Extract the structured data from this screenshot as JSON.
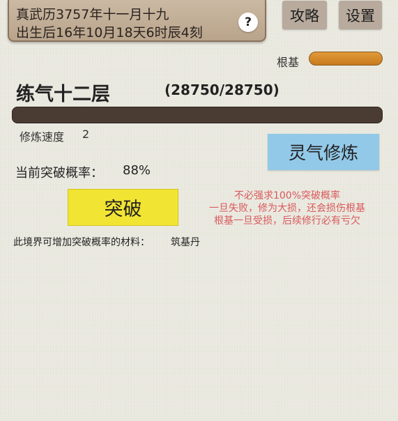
{
  "header": {
    "date_line1": "真武历3757年十一月十九",
    "date_line2": "出生后16年10月18天6时辰4刻",
    "help_label": "?",
    "guide_label": "攻略",
    "settings_label": "设置"
  },
  "root": {
    "label": "根基",
    "level": 1.0,
    "color": "#d8902e"
  },
  "realm": {
    "name": "练气十二层",
    "progress_text": "(28750/28750)",
    "progress_current": 28750,
    "progress_max": 28750,
    "bar_color": "#4a3b33"
  },
  "cultivation": {
    "speed_label": "修炼速度",
    "speed_value": "2",
    "qi_button_label": "灵气修炼"
  },
  "breakthrough": {
    "chance_label": "当前突破概率：",
    "chance_value": "88%",
    "button_label": "突破",
    "button_color": "#f2e433",
    "warnings": [
      "不必强求100%突破概率",
      "一旦失败，修为大损，还会损伤根基",
      "根基一旦受损，后续修行必有亏欠"
    ],
    "warning_color": "#d9595a"
  },
  "materials": {
    "label": "此境界可增加突破概率的材料：",
    "value": "筑基丹"
  }
}
